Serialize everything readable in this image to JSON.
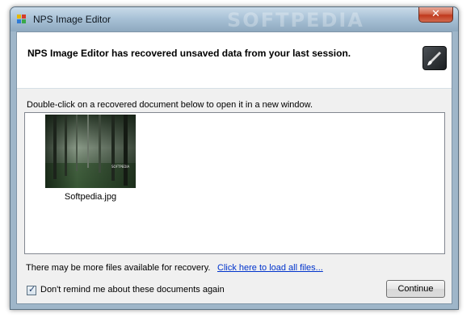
{
  "window": {
    "title": "NPS Image Editor",
    "watermark": "SOFTPEDIA",
    "close_label": "✕"
  },
  "header": {
    "message": "NPS Image Editor has recovered unsaved data from your last session.",
    "icon": "brush-icon"
  },
  "instruction": "Double-click on a recovered document below to open it in a new window.",
  "documents": [
    {
      "name": "Softpedia.jpg",
      "thumbnail_caption": "SOFTPEDIA"
    }
  ],
  "footer": {
    "more_files_text": "There may be more files available for recovery.",
    "load_all_link": "Click here to load all files...",
    "remind_checkbox_label": "Don't remind me about these documents again",
    "remind_checked": true,
    "continue_label": "Continue"
  },
  "colors": {
    "link": "#0033cc",
    "close_button": "#c0391d"
  }
}
